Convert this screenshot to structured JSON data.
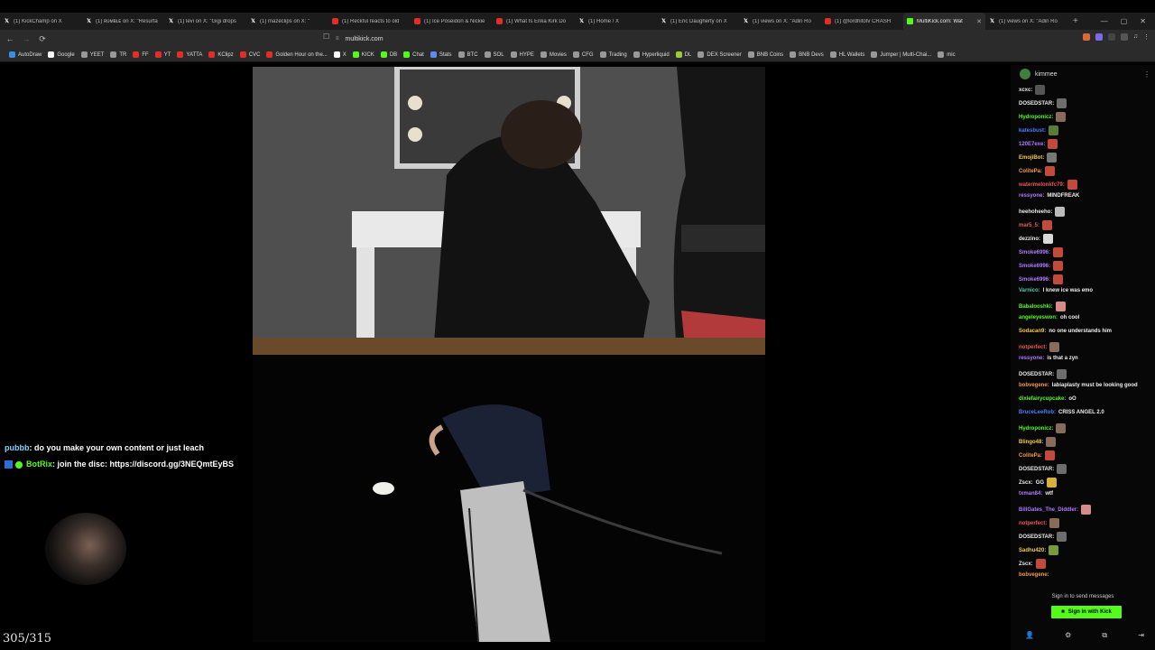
{
  "tabs": [
    {
      "title": "(1) KickChamp on X",
      "icon": "x",
      "active": false
    },
    {
      "title": "(1) ʀᴜᴍʙʟᴇ on X: \"Resurfa",
      "icon": "x",
      "active": false
    },
    {
      "title": "(1) levi on X: \"Gigi drops",
      "icon": "x",
      "active": false
    },
    {
      "title": "(1) mazeclips on X: \"",
      "icon": "x",
      "active": false
    },
    {
      "title": "(1) Reckful reacts to old",
      "icon": "yt",
      "active": false
    },
    {
      "title": "(1) Ice Poseidon & Nickie",
      "icon": "yt",
      "active": false
    },
    {
      "title": "(1) What Is Erika Kirk Do",
      "icon": "yt",
      "active": false
    },
    {
      "title": "(1) Home / X",
      "icon": "x",
      "active": false
    },
    {
      "title": "(1) Eric Daugherty on X",
      "icon": "x",
      "active": false
    },
    {
      "title": "(1) views on X: \"Adin Ro",
      "icon": "x",
      "active": false
    },
    {
      "title": "(1) @lordhitotv CRASH",
      "icon": "yt",
      "active": false
    },
    {
      "title": "MultiKick.com: Wat",
      "icon": "kick",
      "active": true
    },
    {
      "title": "(1) views on X: \"Adin Ro",
      "icon": "x",
      "active": false
    }
  ],
  "address": {
    "url": "multikick.com"
  },
  "bookmarks": [
    {
      "label": "AutoDraw",
      "color": "#3a8ee6"
    },
    {
      "label": "Google",
      "color": "#ffffff"
    },
    {
      "label": "YEET",
      "color": "#999999"
    },
    {
      "label": "TR",
      "color": "#999999"
    },
    {
      "label": "FF",
      "color": "#e52d27"
    },
    {
      "label": "YT",
      "color": "#e52d27"
    },
    {
      "label": "YATTA",
      "color": "#e52d27"
    },
    {
      "label": "KClipz",
      "color": "#e52d27"
    },
    {
      "label": "CVC",
      "color": "#e52d27"
    },
    {
      "label": "Golden Hour on the...",
      "color": "#e52d27"
    },
    {
      "label": "X",
      "color": "#ffffff"
    },
    {
      "label": "KICK",
      "color": "#53fc18"
    },
    {
      "label": "DB",
      "color": "#53fc18"
    },
    {
      "label": "Chat",
      "color": "#53fc18"
    },
    {
      "label": "Stats",
      "color": "#5b8def"
    },
    {
      "label": "BTC",
      "color": "#999999"
    },
    {
      "label": "SOL",
      "color": "#999999"
    },
    {
      "label": "HYPE",
      "color": "#999999"
    },
    {
      "label": "Movies",
      "color": "#999999"
    },
    {
      "label": "CFG",
      "color": "#999999"
    },
    {
      "label": "Trading",
      "color": "#999999"
    },
    {
      "label": "Hyperliquid",
      "color": "#999999"
    },
    {
      "label": "DL",
      "color": "#9acd32"
    },
    {
      "label": "DEX Screener",
      "color": "#999999"
    },
    {
      "label": "BNB Coins",
      "color": "#999999"
    },
    {
      "label": "BNB Devs",
      "color": "#999999"
    },
    {
      "label": "HL Wallets",
      "color": "#999999"
    },
    {
      "label": "Jumper | Multi-Chai...",
      "color": "#999999"
    },
    {
      "label": "mic",
      "color": "#999999"
    }
  ],
  "overlay": {
    "line1_user": "pubbb",
    "line1_text": ": do you make your own content or just leach",
    "line2_user": "BotRix",
    "line2_text": ": join the disc: https://discord.gg/3NEQmtEyBS",
    "counter": "305/315"
  },
  "chat": {
    "channel": "kimmee",
    "messages": [
      {
        "user": "xcxc:",
        "color": "#e9e9e9",
        "text": "",
        "emote": "#555555"
      },
      {
        "user": "DOSEDSTAR:",
        "color": "#e9e9e9",
        "text": "",
        "emote": "#6d6d6d"
      },
      {
        "user": "Hydroponicz:",
        "color": "#53fc18",
        "text": "",
        "emote": "#8a6a5a"
      },
      {
        "user": "katesbust:",
        "color": "#4a7dff",
        "text": "",
        "emote": "#5a7a3a"
      },
      {
        "user": "120E7exe:",
        "color": "#b07aff",
        "text": "",
        "emote": "#c24a3a"
      },
      {
        "user": "EmojiBot:",
        "color": "#f2c94c",
        "text": "",
        "emote": "#777777"
      },
      {
        "user": "ColitePa:",
        "color": "#f2994a",
        "text": "",
        "emote": "#c24a3a"
      },
      {
        "user": "watermelonkfc79:",
        "color": "#eb5757",
        "text": "",
        "emote": "#c24a3a"
      },
      {
        "user": "ressyone:",
        "color": "#b07aff",
        "text": "MINDFREAK",
        "emote": ""
      },
      {
        "user": "heehoheeho:",
        "color": "#e9e9e9",
        "text": "",
        "emote": "#bbbbbb"
      },
      {
        "user": "mar5_5:",
        "color": "#eb5757",
        "text": "",
        "emote": "#c24a3a"
      },
      {
        "user": "dezzino:",
        "color": "#e9e9e9",
        "text": "",
        "emote": "#d9d9d9"
      },
      {
        "user": "Smoke6996:",
        "color": "#b07aff",
        "text": "",
        "emote": "#c24a3a"
      },
      {
        "user": "Smoke6996:",
        "color": "#b07aff",
        "text": "",
        "emote": "#c24a3a"
      },
      {
        "user": "Smoke6996:",
        "color": "#b07aff",
        "text": "",
        "emote": "#c24a3a"
      },
      {
        "user": "Varnico:",
        "color": "#4ec9b0",
        "text": "I knew ice was emo",
        "emote": ""
      },
      {
        "user": "Babalooshki:",
        "color": "#53fc18",
        "text": "",
        "emote": "#d68a8a"
      },
      {
        "user": "angeleyeswon:",
        "color": "#53fc18",
        "text": "oh cool",
        "emote": ""
      },
      {
        "user": "Sodacan9:",
        "color": "#f2c94c",
        "text": "no one understands him",
        "emote": ""
      },
      {
        "user": "notperfect:",
        "color": "#eb5757",
        "text": "",
        "emote": "#8a6a5a"
      },
      {
        "user": "ressyone:",
        "color": "#b07aff",
        "text": "is that a zyn",
        "emote": ""
      },
      {
        "user": "DOSEDSTAR:",
        "color": "#e9e9e9",
        "text": "",
        "emote": "#6d6d6d"
      },
      {
        "user": "bobvegene:",
        "color": "#f2994a",
        "text": "labiaplasty must be looking good",
        "emote": ""
      },
      {
        "user": "dixiefairycupcake:",
        "color": "#53fc18",
        "text": "oO",
        "emote": ""
      },
      {
        "user": "BruceLeeRob:",
        "color": "#4a7dff",
        "text": "CRISS ANGEL 2.0",
        "emote": ""
      },
      {
        "user": "Hydroponicz:",
        "color": "#53fc18",
        "text": "",
        "emote": "#8a6a5a"
      },
      {
        "user": "Blingo48:",
        "color": "#f2c94c",
        "text": "",
        "emote": "#8a6a5a"
      },
      {
        "user": "ColitePa:",
        "color": "#f2994a",
        "text": "",
        "emote": "#c24a3a"
      },
      {
        "user": "DOSEDSTAR:",
        "color": "#e9e9e9",
        "text": "",
        "emote": "#6d6d6d"
      },
      {
        "user": "Zscx:",
        "color": "#e9e9e9",
        "text": "GG",
        "emote": "#d9b03a"
      },
      {
        "user": "txman84:",
        "color": "#b07aff",
        "text": "wtf",
        "emote": ""
      },
      {
        "user": "BillGates_The_Diddler:",
        "color": "#b07aff",
        "text": "",
        "emote": "#d68a8a"
      },
      {
        "user": "notperfect:",
        "color": "#eb5757",
        "text": "",
        "emote": "#8a6a5a"
      },
      {
        "user": "DOSEDSTAR:",
        "color": "#e9e9e9",
        "text": "",
        "emote": "#6d6d6d"
      },
      {
        "user": "Sadhu420:",
        "color": "#f2c94c",
        "text": "",
        "emote": "#7a9a3a"
      },
      {
        "user": "Zscx:",
        "color": "#e9e9e9",
        "text": "",
        "emote": "#c24a3a"
      },
      {
        "user": "bobvegene:",
        "color": "#f2994a",
        "text": "",
        "emote": ""
      }
    ],
    "signin_hint": "Sign in to send messages",
    "signin_button": "Sign in with Kick"
  }
}
